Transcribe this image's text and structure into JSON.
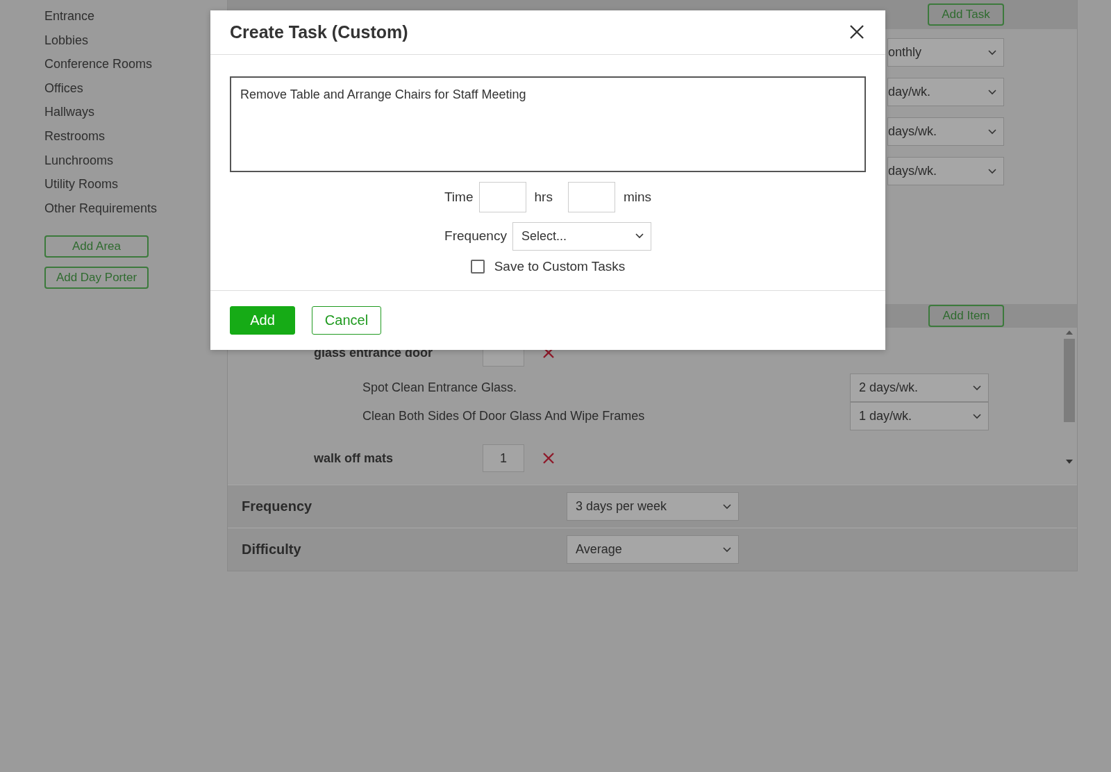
{
  "sidebar": {
    "items": [
      "Entrance",
      "Lobbies",
      "Conference Rooms",
      "Offices",
      "Hallways",
      "Restrooms",
      "Lunchrooms",
      "Utility Rooms",
      "Other Requirements"
    ],
    "buttons": [
      "Add Area",
      "Add Day Porter"
    ]
  },
  "tasks_panel": {
    "add_button": "Add Task",
    "frequency_selects": [
      "onthly",
      "day/wk.",
      "days/wk.",
      "days/wk."
    ]
  },
  "items_panel": {
    "add_button": "Add Item",
    "items": [
      {
        "name": "glass entrance door",
        "tasks": [
          {
            "name": "Spot Clean Entrance Glass.",
            "frequency": "2 days/wk."
          },
          {
            "name": "Clean Both Sides Of Door Glass And Wipe Frames",
            "frequency": "1 day/wk."
          }
        ]
      },
      {
        "name": "walk off mats",
        "quantity": "1"
      }
    ]
  },
  "settings": [
    {
      "label": "Frequency",
      "value": "3 days per week"
    },
    {
      "label": "Difficulty",
      "value": "Average"
    }
  ],
  "dialog": {
    "title": "Create Task (Custom)",
    "description": "Remove Table and Arrange Chairs for Staff Meeting",
    "time_label": "Time",
    "hours": {
      "unit": "hrs"
    },
    "minutes": {
      "unit": "mins"
    },
    "frequency": {
      "label": "Frequency",
      "value": "Select..."
    },
    "save_to_custom": {
      "label": "Save to Custom Tasks",
      "checked": false
    },
    "buttons": [
      {
        "label": "Add",
        "kind": "primary"
      },
      {
        "label": "Cancel",
        "kind": "secondary"
      }
    ]
  }
}
